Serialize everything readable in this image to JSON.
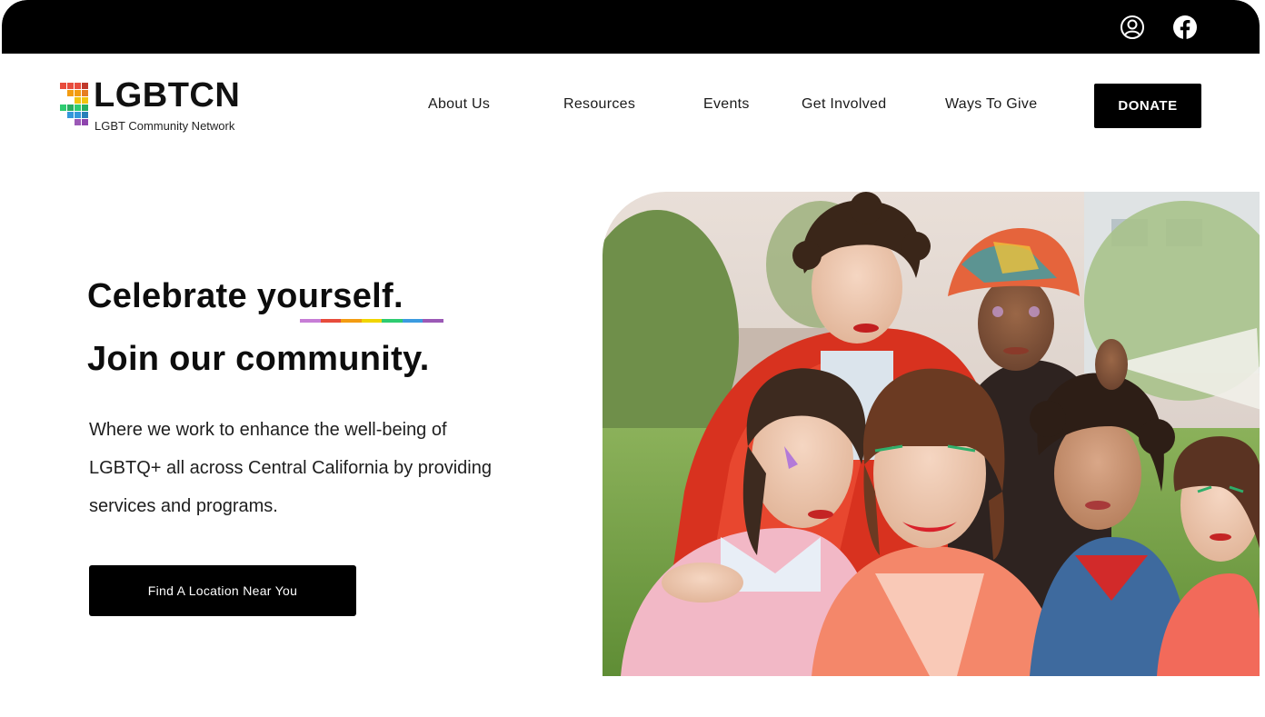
{
  "brand": {
    "name": "LGBTCN",
    "tagline": "LGBT Community Network",
    "logo_colors": [
      "#e84c3d",
      "#f39c12",
      "#f1c40f",
      "#2ecc71",
      "#3498db",
      "#9b59b6"
    ]
  },
  "topbar": {
    "icons": [
      "user-icon",
      "facebook-icon"
    ]
  },
  "nav": {
    "items": [
      {
        "label": "About Us"
      },
      {
        "label": "Resources"
      },
      {
        "label": "Events"
      },
      {
        "label": "Get Involved"
      },
      {
        "label": "Ways To Give"
      }
    ],
    "donate_label": "DONATE"
  },
  "hero": {
    "headline_line1_prefix": "Celebrate ",
    "headline_line1_highlight": "yourself.",
    "headline_line2": "Join our community.",
    "description": "Where we work to enhance the well-being of LGBTQ+ all across Central California by providing services and programs.",
    "cta_label": "Find A Location Near You",
    "underline_colors": [
      "#c77dd6",
      "#e74c3c",
      "#f39c12",
      "#f1d500",
      "#2ecc71",
      "#3b9be0",
      "#9b59b6"
    ]
  }
}
